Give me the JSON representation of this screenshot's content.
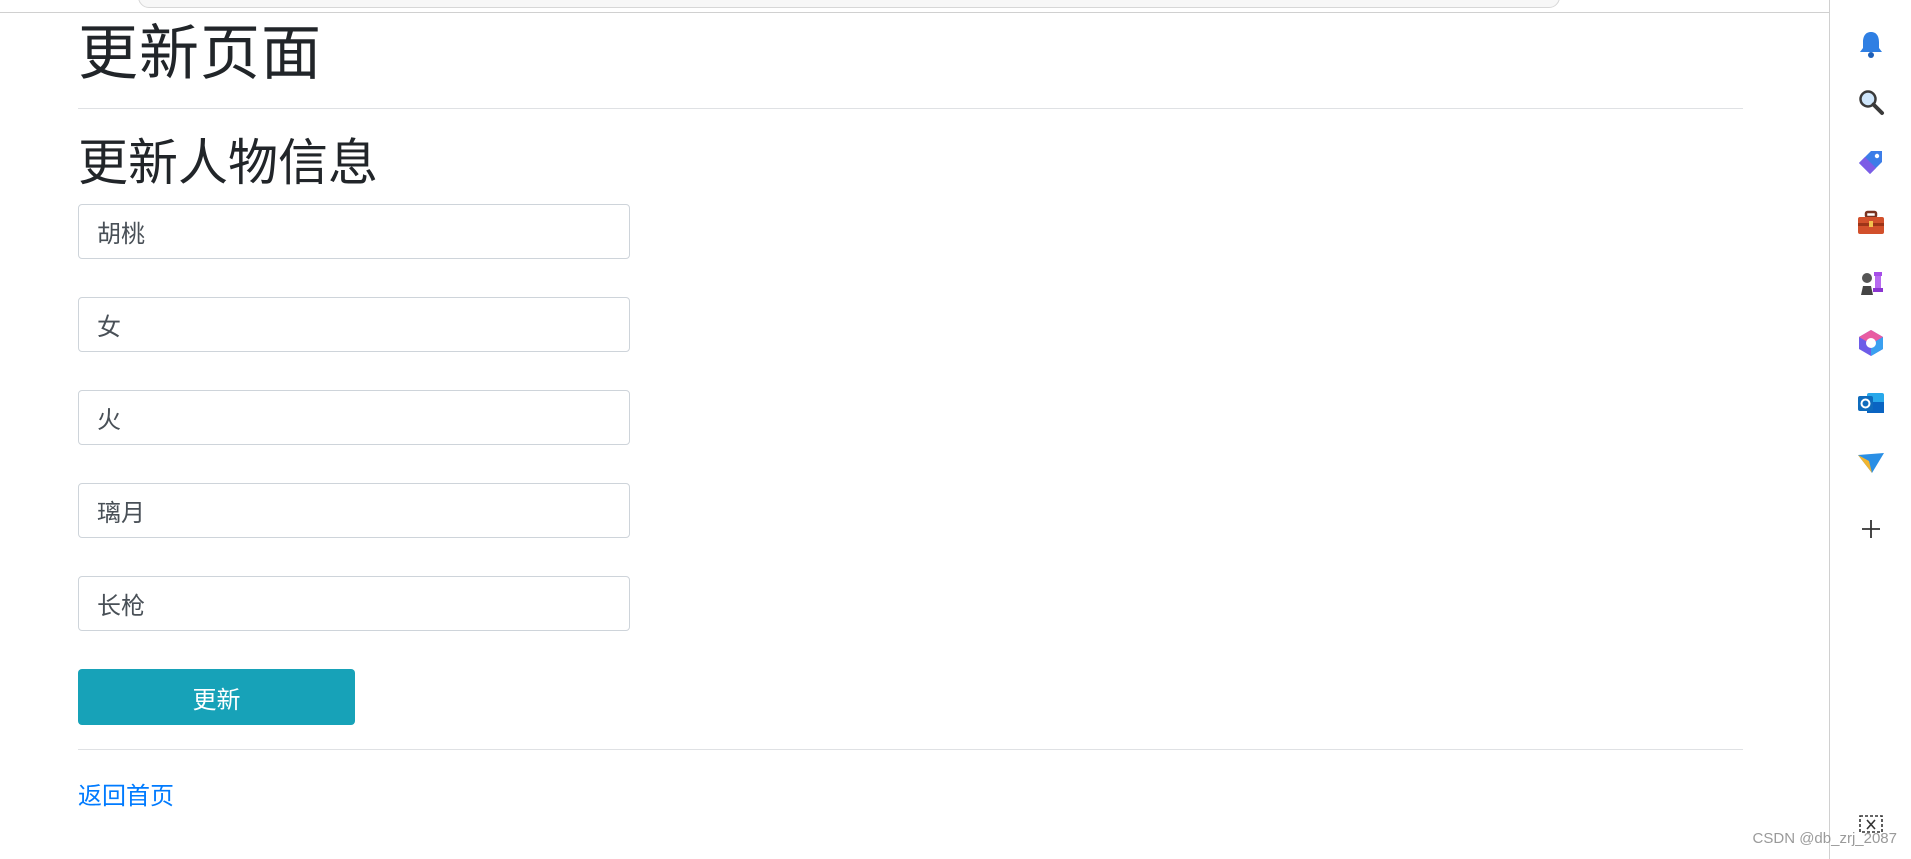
{
  "page": {
    "title": "更新页面",
    "section_title": "更新人物信息"
  },
  "form": {
    "fields": [
      {
        "value": "胡桃"
      },
      {
        "value": "女"
      },
      {
        "value": "火"
      },
      {
        "value": "璃月"
      },
      {
        "value": "长枪"
      }
    ],
    "submit_label": "更新"
  },
  "footer": {
    "back_link": "返回首页"
  },
  "sidebar": {
    "icons": [
      "bell-icon",
      "search-icon",
      "tag-icon",
      "toolbox-icon",
      "chess-icon",
      "office-icon",
      "outlook-icon",
      "send-icon",
      "add-icon",
      "screenshot-icon"
    ]
  },
  "watermark": "CSDN @db_zrj_2087",
  "colors": {
    "button": "#17a2b8",
    "link": "#007bff",
    "divider": "#dfe1e4",
    "input_border": "#ced4da"
  }
}
